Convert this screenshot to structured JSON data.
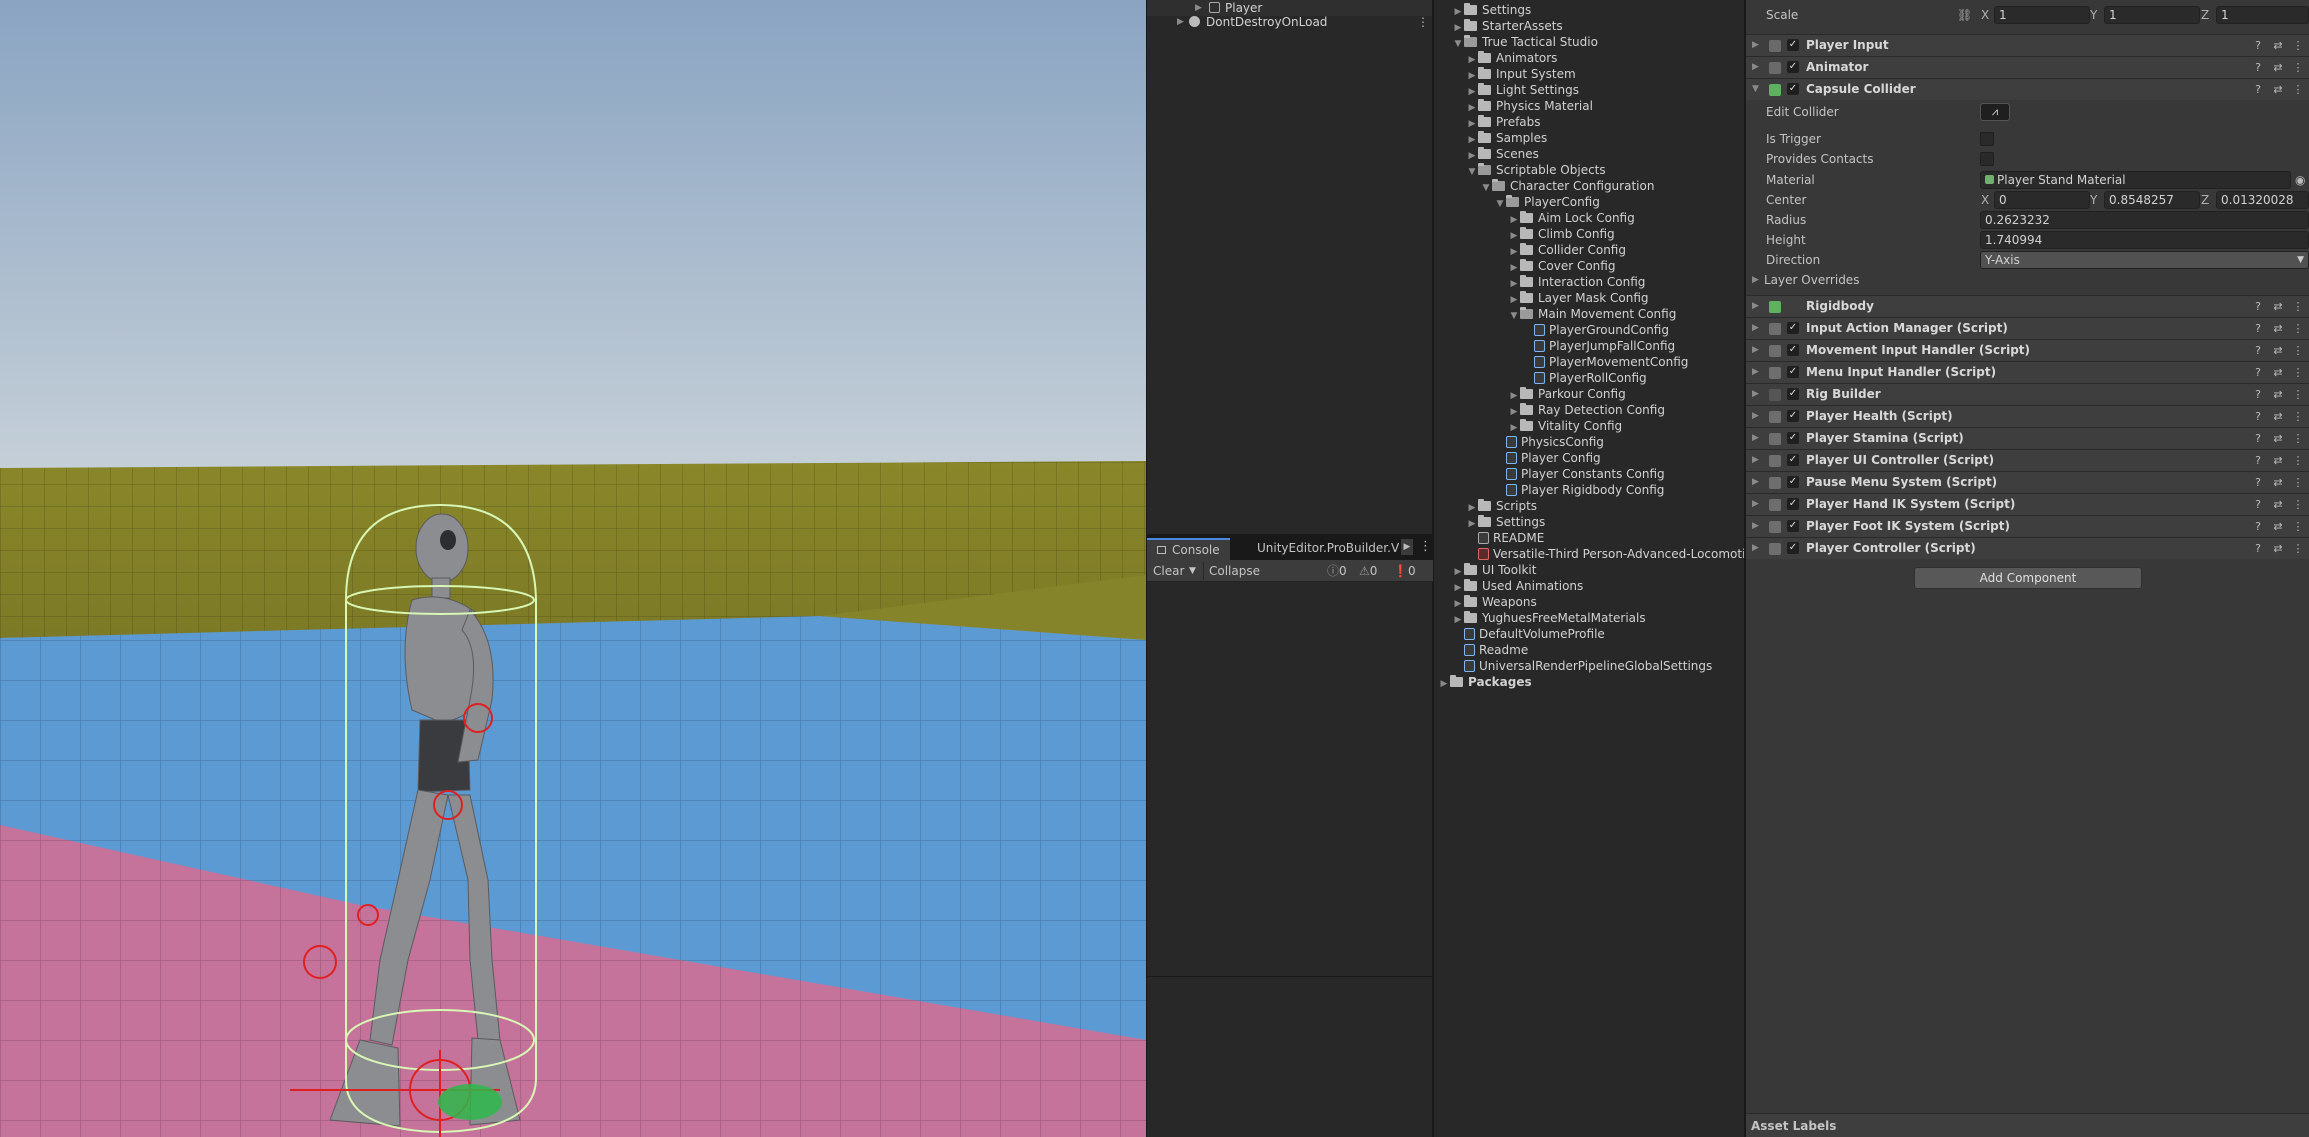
{
  "hierarchy": {
    "items": [
      {
        "label": "Player",
        "icon": "prefab-icon"
      },
      {
        "label": "DontDestroyOnLoad",
        "icon": "scene-icon"
      }
    ]
  },
  "console": {
    "tabs": [
      "Console",
      "UnityEditor.ProBuilder.V"
    ],
    "clear_label": "Clear",
    "collapse_label": "Collapse",
    "info_count": "0",
    "warning_count": "0",
    "error_count": "0"
  },
  "project": {
    "items": [
      {
        "label": "Settings",
        "type": "folder"
      },
      {
        "label": "StarterAssets",
        "type": "folder"
      },
      {
        "label": "True Tactical Studio",
        "type": "folder"
      },
      {
        "label": "Animators",
        "type": "folder"
      },
      {
        "label": "Input System",
        "type": "folder"
      },
      {
        "label": "Light Settings",
        "type": "folder"
      },
      {
        "label": "Physics Material",
        "type": "folder"
      },
      {
        "label": "Prefabs",
        "type": "folder"
      },
      {
        "label": "Samples",
        "type": "folder"
      },
      {
        "label": "Scenes",
        "type": "folder"
      },
      {
        "label": "Scriptable Objects",
        "type": "folder"
      },
      {
        "label": "Character Configuration",
        "type": "folder"
      },
      {
        "label": "PlayerConfig",
        "type": "folder"
      },
      {
        "label": "Aim Lock Config",
        "type": "folder"
      },
      {
        "label": "Climb Config",
        "type": "folder"
      },
      {
        "label": "Collider Config",
        "type": "folder"
      },
      {
        "label": "Cover Config",
        "type": "folder"
      },
      {
        "label": "Interaction Config",
        "type": "folder"
      },
      {
        "label": "Layer Mask Config",
        "type": "folder"
      },
      {
        "label": "Main Movement Config",
        "type": "folder"
      },
      {
        "label": "PlayerGroundConfig",
        "type": "asset"
      },
      {
        "label": "PlayerJumpFallConfig",
        "type": "asset"
      },
      {
        "label": "PlayerMovementConfig",
        "type": "asset"
      },
      {
        "label": "PlayerRollConfig",
        "type": "asset"
      },
      {
        "label": "Parkour Config",
        "type": "folder"
      },
      {
        "label": "Ray Detection Config",
        "type": "folder"
      },
      {
        "label": "Vitality Config",
        "type": "folder"
      },
      {
        "label": "PhysicsConfig",
        "type": "asset"
      },
      {
        "label": "Player Config",
        "type": "asset"
      },
      {
        "label": "Player Constants Config",
        "type": "asset"
      },
      {
        "label": "Player Rigidbody Config",
        "type": "asset"
      },
      {
        "label": "Scripts",
        "type": "folder"
      },
      {
        "label": "Settings",
        "type": "folder"
      },
      {
        "label": "README",
        "type": "doc"
      },
      {
        "label": "Versatile-Third Person-Advanced-Locomoti",
        "type": "pdf"
      },
      {
        "label": "UI Toolkit",
        "type": "folder"
      },
      {
        "label": "Used Animations",
        "type": "folder"
      },
      {
        "label": "Weapons",
        "type": "folder"
      },
      {
        "label": "YughuesFreeMetalMaterials",
        "type": "folder"
      },
      {
        "label": "DefaultVolumeProfile",
        "type": "asset"
      },
      {
        "label": "Readme",
        "type": "asset"
      },
      {
        "label": "UniversalRenderPipelineGlobalSettings",
        "type": "asset"
      },
      {
        "label": "Packages",
        "type": "folder"
      }
    ]
  },
  "inspector": {
    "scale": {
      "label": "Scale",
      "x": "1",
      "y": "1",
      "z": "1"
    },
    "components_top": [
      {
        "name": "Player Input",
        "icon": "info-icon",
        "enabled": true
      },
      {
        "name": "Animator",
        "icon": "animator-icon",
        "enabled": true
      }
    ],
    "capsule": {
      "name": "Capsule Collider",
      "edit_collider_label": "Edit Collider",
      "is_trigger_label": "Is Trigger",
      "provides_contacts_label": "Provides Contacts",
      "material_label": "Material",
      "material_value": "Player Stand Material",
      "center_label": "Center",
      "center_x": "0",
      "center_y": "0.8548257",
      "center_z": "0.01320028",
      "radius_label": "Radius",
      "radius_value": "0.2623232",
      "height_label": "Height",
      "height_value": "1.740994",
      "direction_label": "Direction",
      "direction_value": "Y-Axis",
      "layer_overrides_label": "Layer Overrides"
    },
    "components_bottom": [
      {
        "name": "Rigidbody",
        "icon": "rigidbody-icon",
        "enabled": false
      },
      {
        "name": "Input Action Manager (Script)",
        "icon": "script-icon",
        "enabled": true
      },
      {
        "name": "Movement Input Handler (Script)",
        "icon": "script-icon",
        "enabled": true
      },
      {
        "name": "Menu Input Handler (Script)",
        "icon": "script-icon",
        "enabled": true
      },
      {
        "name": "Rig Builder",
        "icon": "rig-icon",
        "enabled": true
      },
      {
        "name": "Player Health (Script)",
        "icon": "script-icon",
        "enabled": true
      },
      {
        "name": "Player Stamina (Script)",
        "icon": "script-icon",
        "enabled": true
      },
      {
        "name": "Player UI Controller (Script)",
        "icon": "script-icon",
        "enabled": true
      },
      {
        "name": "Pause Menu System (Script)",
        "icon": "script-icon",
        "enabled": true
      },
      {
        "name": "Player Hand IK System (Script)",
        "icon": "script-icon",
        "enabled": true
      },
      {
        "name": "Player Foot IK System (Script)",
        "icon": "script-icon",
        "enabled": true
      },
      {
        "name": "Player Controller (Script)",
        "icon": "script-icon",
        "enabled": true
      }
    ],
    "add_component_label": "Add Component",
    "asset_labels": "Asset Labels"
  },
  "colors": {
    "accent": "#4a8ae0",
    "floor_pink": "#c4729a",
    "floor_blue": "#5a9ad6",
    "wall_olive": "#8c8a2c",
    "gizmo_green": "#c8f0a0",
    "gizmo_red": "#e02020"
  }
}
